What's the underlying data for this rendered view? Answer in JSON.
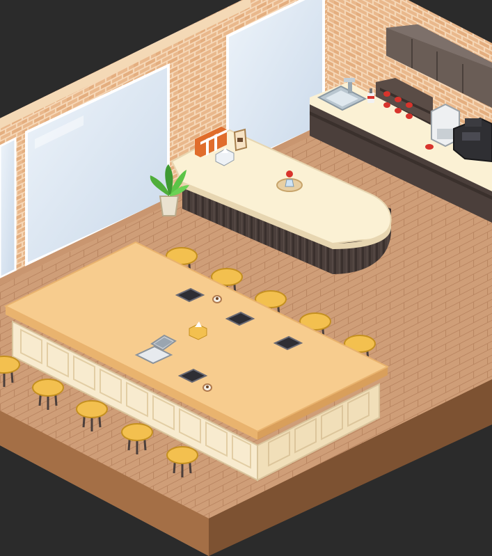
{
  "scene": {
    "kind": "isometric pixel-art cafe / co-working room",
    "palette": {
      "background": "#2b2b2b",
      "floor": "#cf9e78",
      "floor_dark": "#b98561",
      "floor_edge_front": "#a46f46",
      "floor_edge_side": "#7d5232",
      "brick": "#e9b88c",
      "brick_mortar": "#f6d8b8",
      "glass": "#dbe7f3",
      "wall_trim": "#f4d9b6",
      "table_top": "#f7cc8e",
      "table_edge": "#e9b36e",
      "table_panel": "#f8ebcf",
      "counter_top": "#fbf1d4",
      "counter_skirt": "#4b3f3b",
      "stool_seat": "#f3c04f",
      "cabinet": "#6a5d56",
      "cup_red": "#d8342c"
    },
    "objects": {
      "stools_back_row": 5,
      "stools_front_row": 5,
      "tablets_on_table": 4,
      "coffee_cups_on_table": 2,
      "laptops": 1,
      "tissue_boxes": 2,
      "plants": 1,
      "red_cups_on_shelf": 6
    }
  }
}
